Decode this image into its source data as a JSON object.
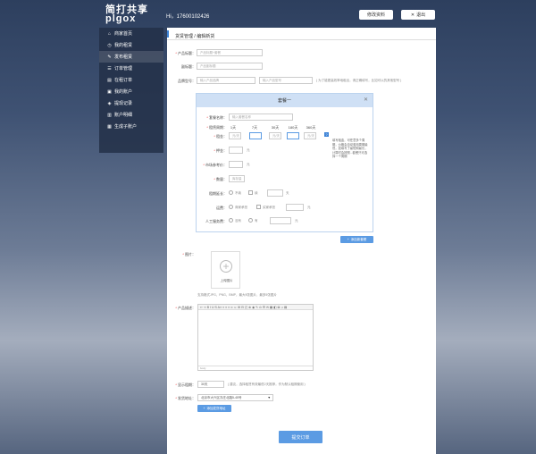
{
  "header": {
    "logo_cn": "简打共享",
    "logo_en": "plgox",
    "greeting": "Hi，17600102426",
    "edit_profile": "修改资料",
    "logout": "退出"
  },
  "sidebar": {
    "items": [
      {
        "label": "商家首页",
        "icon": "home-icon"
      },
      {
        "label": "我的租赁",
        "icon": "clock-icon"
      },
      {
        "label": "发布租赁",
        "icon": "pencil-icon"
      },
      {
        "label": "订单管理",
        "icon": "list-icon"
      },
      {
        "label": "在租订单",
        "icon": "document-icon"
      },
      {
        "label": "我的账户",
        "icon": "account-icon"
      },
      {
        "label": "提现记录",
        "icon": "withdraw-icon"
      },
      {
        "label": "账户明细",
        "icon": "detail-icon"
      },
      {
        "label": "生成子账户",
        "icon": "subaccount-icon"
      }
    ],
    "active_index": 2
  },
  "breadcrumb": {
    "parent": "货赁管理",
    "sep": "/",
    "current": "编辑新货"
  },
  "form": {
    "product_title": {
      "label": "产品标题：",
      "placeholder": "产品标题+套餐"
    },
    "subtitle": {
      "label": "副标题：",
      "placeholder": "产品副标题"
    },
    "brand_model": {
      "label": "品牌型号：",
      "brand_placeholder": "输入产品品牌",
      "model_placeholder": "输入产品型号",
      "hint": "( 为了能更高效率地租出，请正确填写，比如可以的其他型号 )"
    },
    "package": {
      "title": "套餐一",
      "name_label": "套餐名称：",
      "name_placeholder": "输入套餐名称",
      "period_label": "租赁周期：",
      "periods": [
        "1天",
        "7天",
        "30天",
        "180天",
        "360天"
      ],
      "rent_label": "租金：",
      "rent_values": [
        "元/天",
        "",
        "元/天",
        "",
        "元/天"
      ],
      "deposit_label": "押金：",
      "deposit_unit": "元",
      "market_label": "市场参考价：",
      "market_unit": "元",
      "qty_label": "数量：",
      "qty_placeholder": "库存量",
      "renew_label": "租期延长：",
      "renew_no": "不续",
      "renew_yes": "续",
      "renew_unit": "天",
      "ship_label": "运费：",
      "ship_seller": "商家承担",
      "ship_buyer": "买家承担",
      "ship_unit": "元",
      "labor_label": "人工服务费：",
      "labor_no": "没有",
      "labor_yes": "有",
      "labor_unit": "元",
      "help": "填写租金，可任意多个周期，价格会自动套用周期最低，如填写了最短和最长，计算时会按照...套餐只可选择一个周期"
    },
    "add_package": "添加新套餐",
    "image": {
      "label": "图片：",
      "upload": "上传图片",
      "hint": "支持格式JPG、PNG、BMP，最大5张图片，最多5张图片"
    },
    "description": {
      "label": "产品描述：",
      "toolbar": "⇐ ⇒ B I U S A≡ ≡ ≡ ≡ ∞ ☺ ⊞ ⊟ ◰ ⊗ ◉ ✎ ⊙ ☰ ✉ ▦ ◧ ⊠ ♫ ▤",
      "status": "body"
    },
    "display_days": {
      "label": "显示租期：",
      "placeholder": "30天",
      "hint": "( 建议，选择租赁有效最低2天推荐，作为默认租期使用 )"
    },
    "ship_address": {
      "label": "发货地址：",
      "value": "北京市大兴区亦庄北路5-45号"
    },
    "add_address": "添加发货地址",
    "submit": "提交订单"
  },
  "colors": {
    "accent": "#5b9be3",
    "sidebar": "#233048",
    "panel_head": "#cfe0f5"
  }
}
